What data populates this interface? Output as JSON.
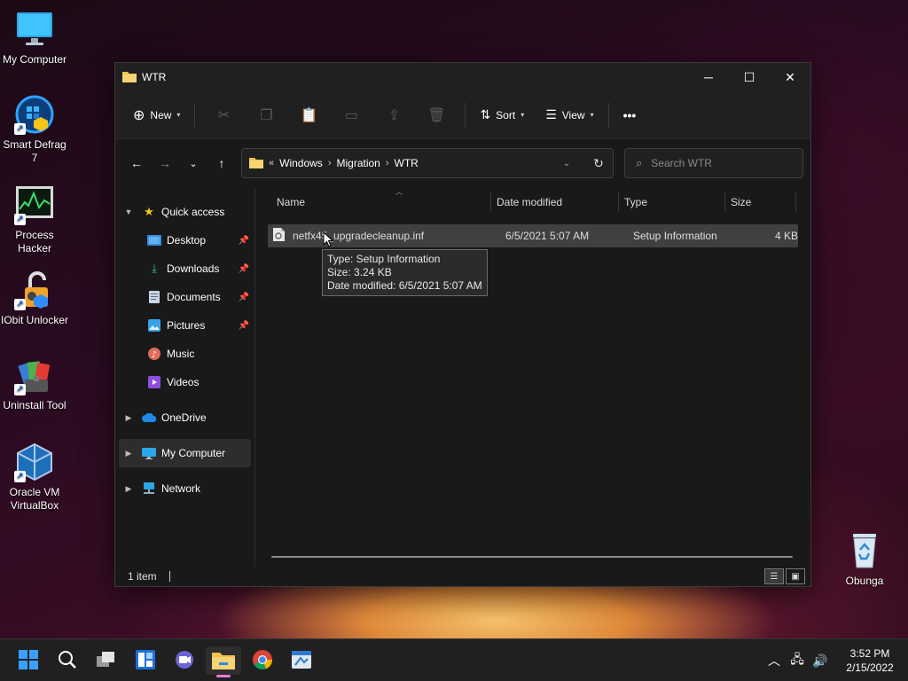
{
  "desktop": {
    "icons": [
      {
        "label": "My Computer"
      },
      {
        "label": "Smart Defrag 7"
      },
      {
        "label": "Process Hacker"
      },
      {
        "label": "IObit Unlocker"
      },
      {
        "label": "Uninstall Tool"
      },
      {
        "label": "Oracle VM VirtualBox"
      },
      {
        "label": "Obunga"
      }
    ]
  },
  "window": {
    "title": "WTR",
    "toolbar": {
      "new_label": "New",
      "sort_label": "Sort",
      "view_label": "View",
      "more_label": "•••"
    },
    "address": {
      "overflow": "«",
      "crumbs": [
        "Windows",
        "Migration",
        "WTR"
      ]
    },
    "search": {
      "placeholder": "Search WTR"
    },
    "nav": {
      "quick_access": "Quick access",
      "items": [
        "Desktop",
        "Downloads",
        "Documents",
        "Pictures",
        "Music",
        "Videos"
      ],
      "onedrive": "OneDrive",
      "my_computer": "My Computer",
      "network": "Network"
    },
    "columns": {
      "name": "Name",
      "date": "Date modified",
      "type": "Type",
      "size": "Size"
    },
    "files": [
      {
        "name": "netfx45_upgradecleanup.inf",
        "date": "6/5/2021 5:07 AM",
        "type": "Setup Information",
        "size": "4 KB"
      }
    ],
    "tooltip": {
      "type": "Type: Setup Information",
      "size": "Size: 3.24 KB",
      "date": "Date modified: 6/5/2021 5:07 AM"
    },
    "status": {
      "count": "1 item"
    }
  },
  "taskbar": {
    "clock_time": "3:52 PM",
    "clock_date": "2/15/2022"
  },
  "colors": {
    "accent": "#eb7ad1",
    "folder": "#f2c14e",
    "selection": "#404040"
  }
}
